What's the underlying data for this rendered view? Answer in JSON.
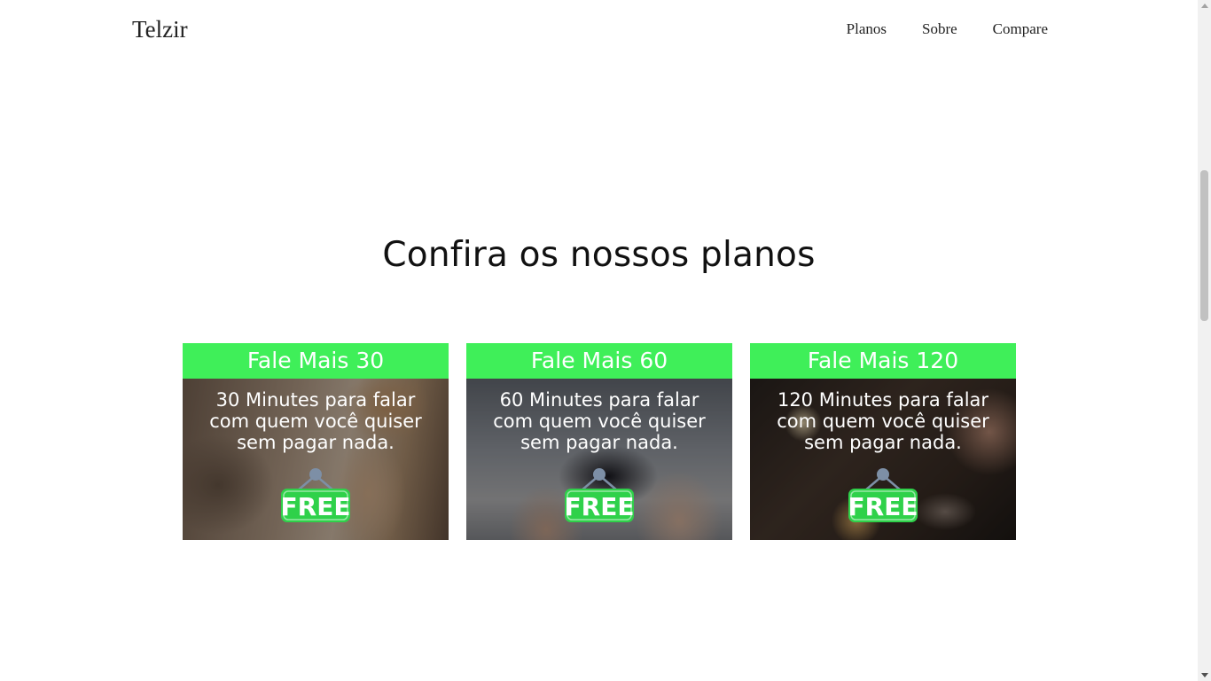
{
  "header": {
    "brand": "Telzir",
    "nav": [
      "Planos",
      "Sobre",
      "Compare"
    ]
  },
  "plans_section": {
    "title": "Confira os nossos planos",
    "cards": [
      {
        "title": "Fale Mais 30",
        "description": "30 Minutes para falar com quem você quiser sem pagar nada.",
        "tag": "FREE"
      },
      {
        "title": "Fale Mais 60",
        "description": "60 Minutes para falar com quem você quiser sem pagar nada.",
        "tag": "FREE"
      },
      {
        "title": "Fale Mais 120",
        "description": "120 Minutes para falar com quem você quiser sem pagar nada.",
        "tag": "FREE"
      }
    ]
  },
  "colors": {
    "card_header": "#3fef59",
    "tag_green": "#2fd14a",
    "tag_pin": "#7d8fa6",
    "text": "#111111"
  },
  "icons": [
    "free-tag-icon"
  ]
}
